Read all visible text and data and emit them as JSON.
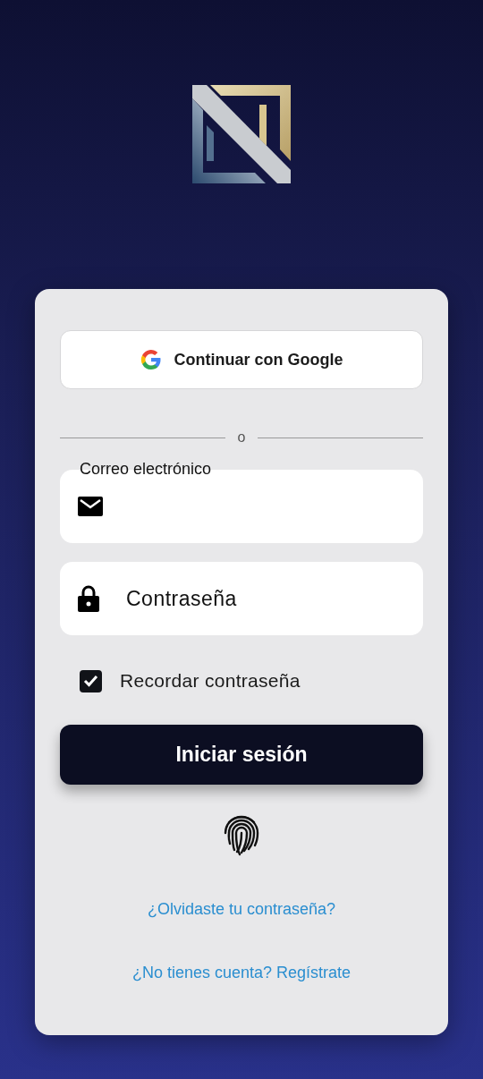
{
  "google_button": {
    "label": "Continuar con Google"
  },
  "divider": {
    "label": "o"
  },
  "email": {
    "label": "Correo electrónico"
  },
  "password": {
    "placeholder": "Contraseña"
  },
  "remember": {
    "label": "Recordar contraseña",
    "checked": true
  },
  "login_button": {
    "label": "Iniciar sesión"
  },
  "links": [
    {
      "label": "¿Olvidaste tu contraseña?"
    },
    {
      "label": "¿No tienes cuenta? Regístrate"
    }
  ]
}
